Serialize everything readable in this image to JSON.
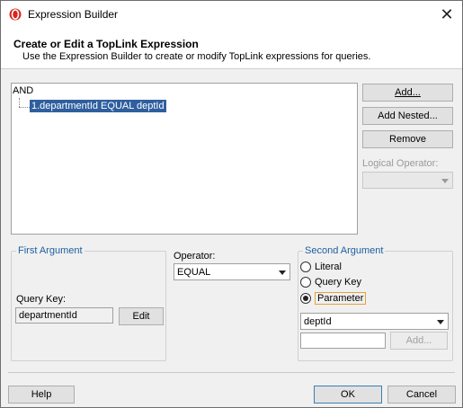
{
  "window": {
    "title": "Expression Builder",
    "close_glyph": "✕"
  },
  "header": {
    "title": "Create or Edit a TopLink Expression",
    "description": "Use the Expression Builder to create or modify TopLink expressions for queries."
  },
  "tree": {
    "root": "AND",
    "nodes": [
      "1.departmentId EQUAL deptId"
    ]
  },
  "side_buttons": {
    "add": "Add...",
    "add_nested": "Add Nested...",
    "remove": "Remove",
    "logical_operator_label": "Logical Operator:",
    "logical_operator_value": ""
  },
  "first_argument": {
    "legend": "First Argument",
    "query_key_label": "Query Key:",
    "query_key_value": "departmentId",
    "edit_label": "Edit"
  },
  "operator": {
    "label": "Operator:",
    "value": "EQUAL"
  },
  "second_argument": {
    "legend": "Second Argument",
    "options": [
      "Literal",
      "Query Key",
      "Parameter"
    ],
    "selected": "Parameter",
    "parameter_value": "deptId",
    "text_value": "",
    "add_label": "Add..."
  },
  "footer": {
    "help": "Help",
    "ok": "OK",
    "cancel": "Cancel"
  },
  "colors": {
    "selection": "#2f5f9e",
    "legend": "#1e5fa0",
    "focus": "#e2a33a"
  }
}
